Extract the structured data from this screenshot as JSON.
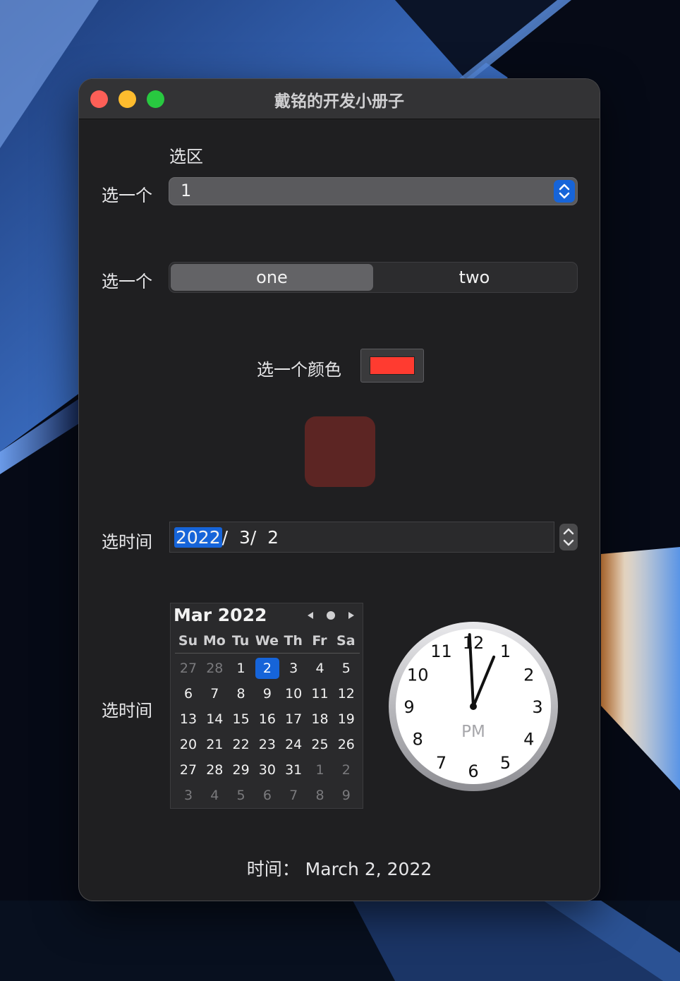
{
  "window": {
    "title": "戴铭的开发小册子"
  },
  "form": {
    "section_title": "选区",
    "popup": {
      "label": "选一个",
      "value": "1"
    },
    "segmented": {
      "label": "选一个",
      "options": [
        "one",
        "two"
      ],
      "selected": "one"
    },
    "color": {
      "label": "选一个颜色",
      "value": "#ff3b30",
      "preview": "#5c2523"
    },
    "date_field": {
      "label": "选时间",
      "year": "2022",
      "rest": "/  3/  2"
    },
    "calendar_label": "选时间"
  },
  "calendar": {
    "month_title": "Mar 2022",
    "weekdays": [
      "Su",
      "Mo",
      "Tu",
      "We",
      "Th",
      "Fr",
      "Sa"
    ],
    "weeks": [
      [
        "27",
        "28",
        "1",
        "2",
        "3",
        "4",
        "5"
      ],
      [
        "6",
        "7",
        "8",
        "9",
        "10",
        "11",
        "12"
      ],
      [
        "13",
        "14",
        "15",
        "16",
        "17",
        "18",
        "19"
      ],
      [
        "20",
        "21",
        "22",
        "23",
        "24",
        "25",
        "26"
      ],
      [
        "27",
        "28",
        "29",
        "30",
        "31",
        "1",
        "2"
      ],
      [
        "3",
        "4",
        "5",
        "6",
        "7",
        "8",
        "9"
      ]
    ],
    "selected_day": "2",
    "nav_icons": [
      "triangle-left-icon",
      "circle-today-icon",
      "triangle-right-icon"
    ]
  },
  "clock": {
    "meridiem": "PM",
    "numbers": [
      "12",
      "1",
      "2",
      "3",
      "4",
      "5",
      "6",
      "7",
      "8",
      "9",
      "10",
      "11"
    ],
    "hour": 12.75,
    "minute": 59.5
  },
  "result": {
    "text": "时间：  March 2, 2022"
  },
  "colors": {
    "accent": "#1664d9",
    "window_bg": "#1f1f21",
    "titlebar_bg": "#333335"
  }
}
